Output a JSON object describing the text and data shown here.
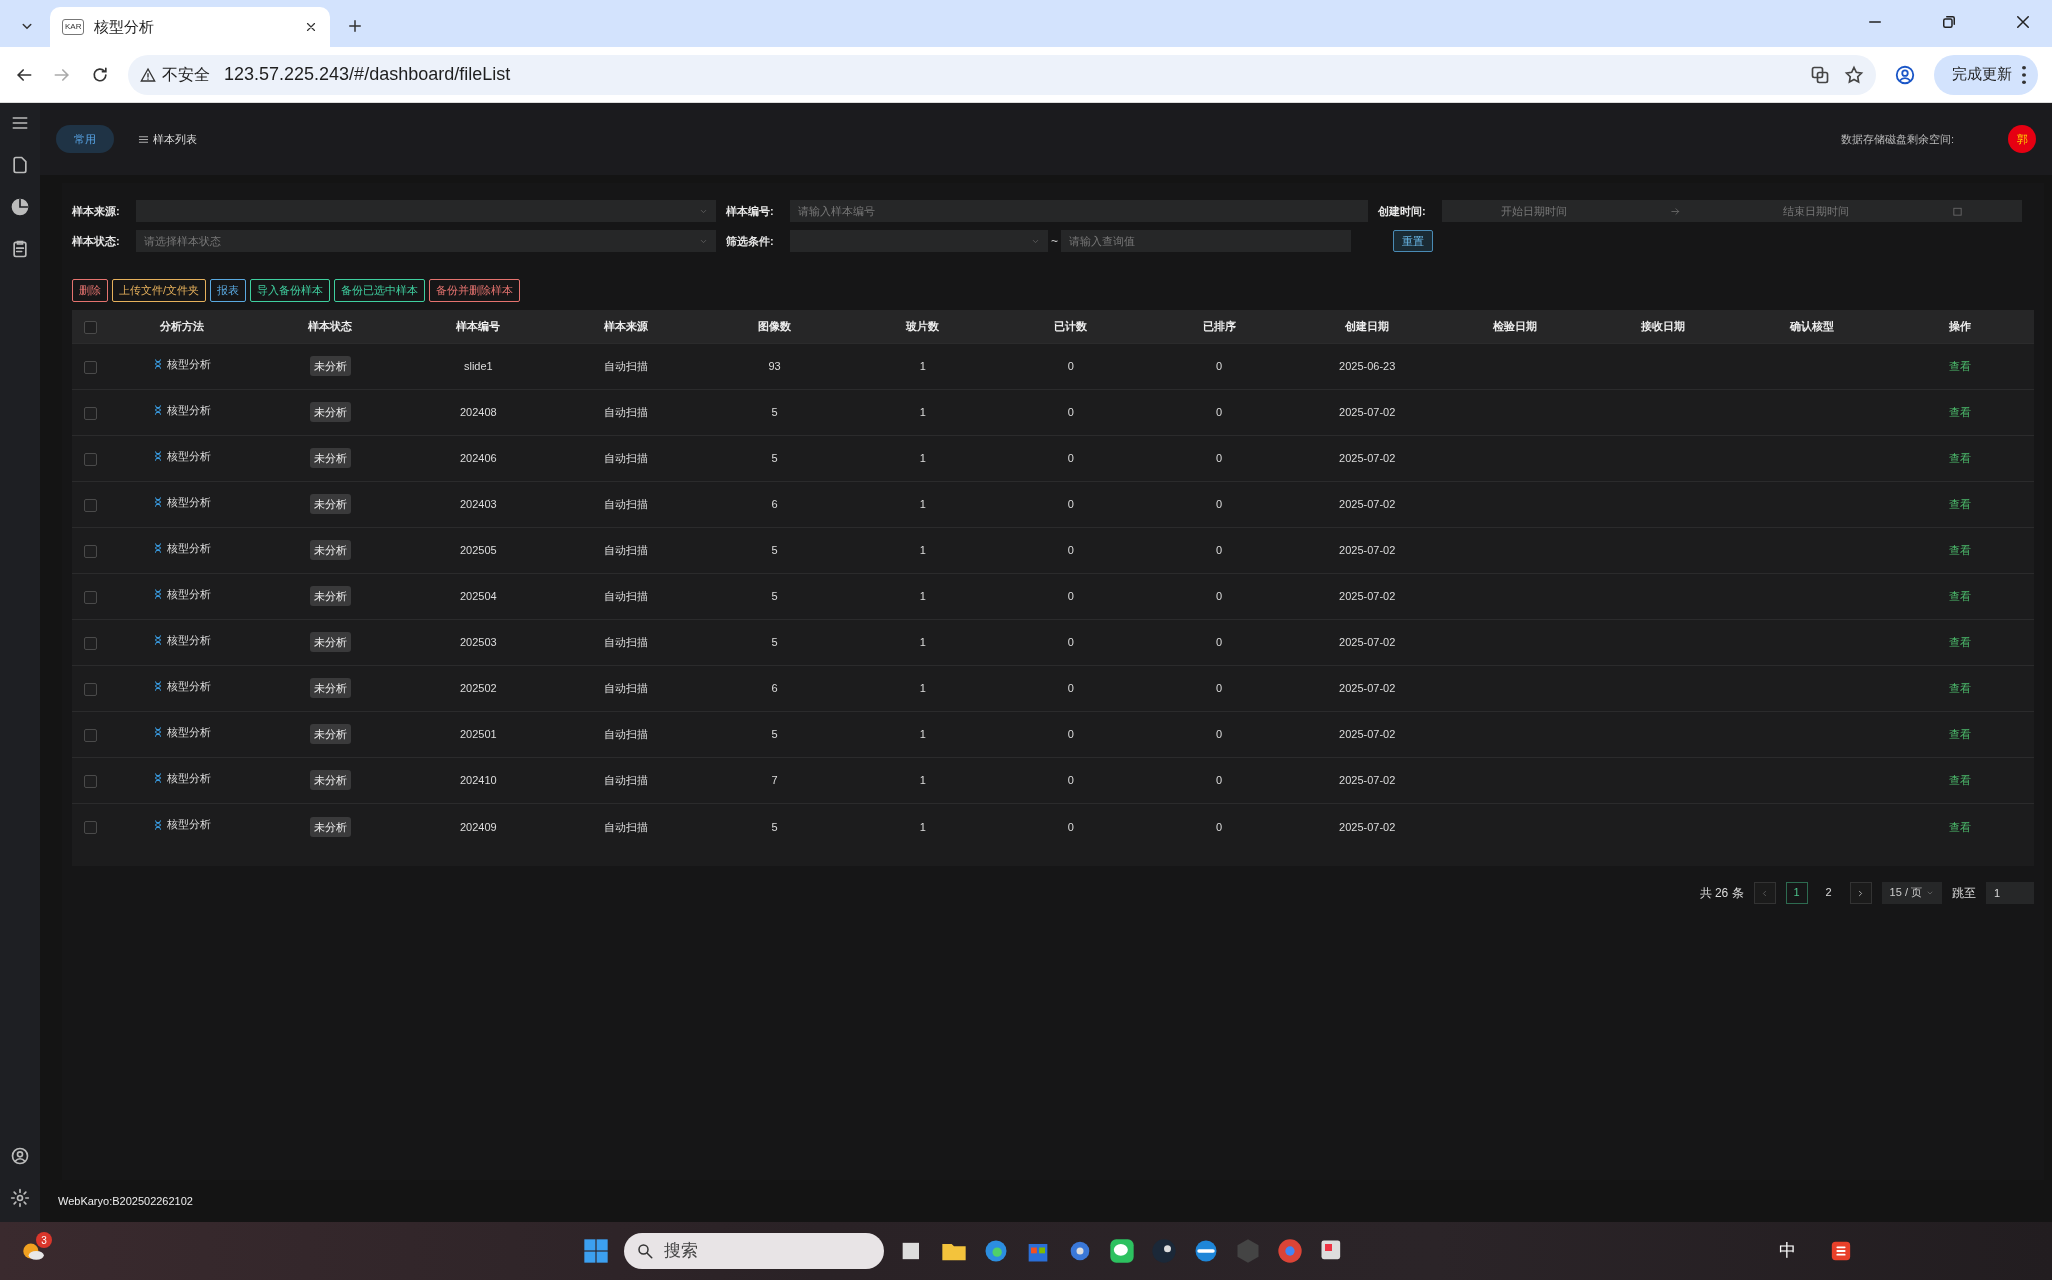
{
  "browser": {
    "tab_title": "核型分析",
    "tab_icon_text": "KAR",
    "security": "不安全",
    "url": "123.57.225.243/#/dashboard/fileList",
    "update_button": "完成更新"
  },
  "header": {
    "tabs": [
      {
        "label": "常用",
        "selected": true
      },
      {
        "label": "样本列表",
        "selected": false
      }
    ],
    "storage_label": "数据存储磁盘剩余空间:",
    "avatar": "郭"
  },
  "filters": {
    "source": {
      "label": "样本来源:"
    },
    "number": {
      "label": "样本编号:",
      "placeholder": "请输入样本编号"
    },
    "created": {
      "label": "创建时间:",
      "start_placeholder": "开始日期时间",
      "end_placeholder": "结束日期时间"
    },
    "status": {
      "label": "样本状态:",
      "placeholder": "请选择样本状态"
    },
    "condition": {
      "label": "筛选条件:",
      "separator": "~",
      "value_placeholder": "请输入查询值"
    },
    "reset_button": "重置"
  },
  "actions": [
    {
      "label": "删除",
      "color": "#e5736f"
    },
    {
      "label": "上传文件/文件夹",
      "color": "#e6b15c"
    },
    {
      "label": "报表",
      "color": "#5aa9e0"
    },
    {
      "label": "导入备份样本",
      "color": "#3fcf9f"
    },
    {
      "label": "备份已选中样本",
      "color": "#3fcf9f"
    },
    {
      "label": "备份并删除样本",
      "color": "#e5736f"
    }
  ],
  "table": {
    "all_checked": false,
    "columns": [
      "分析方法",
      "样本状态",
      "样本编号",
      "样本来源",
      "图像数",
      "玻片数",
      "已计数",
      "已排序",
      "创建日期",
      "检验日期",
      "接收日期",
      "确认核型",
      "操作"
    ],
    "rows": [
      {
        "checked": false,
        "method": "核型分析",
        "status": "未分析",
        "number": "slide1",
        "source": "自动扫描",
        "images": "93",
        "slides": "1",
        "counted": "0",
        "sorted": "0",
        "created": "2025-06-23",
        "action": "查看"
      },
      {
        "checked": false,
        "method": "核型分析",
        "status": "未分析",
        "number": "202408",
        "source": "自动扫描",
        "images": "5",
        "slides": "1",
        "counted": "0",
        "sorted": "0",
        "created": "2025-07-02",
        "action": "查看"
      },
      {
        "checked": false,
        "method": "核型分析",
        "status": "未分析",
        "number": "202406",
        "source": "自动扫描",
        "images": "5",
        "slides": "1",
        "counted": "0",
        "sorted": "0",
        "created": "2025-07-02",
        "action": "查看"
      },
      {
        "checked": false,
        "method": "核型分析",
        "status": "未分析",
        "number": "202403",
        "source": "自动扫描",
        "images": "6",
        "slides": "1",
        "counted": "0",
        "sorted": "0",
        "created": "2025-07-02",
        "action": "查看"
      },
      {
        "checked": false,
        "method": "核型分析",
        "status": "未分析",
        "number": "202505",
        "source": "自动扫描",
        "images": "5",
        "slides": "1",
        "counted": "0",
        "sorted": "0",
        "created": "2025-07-02",
        "action": "查看"
      },
      {
        "checked": false,
        "method": "核型分析",
        "status": "未分析",
        "number": "202504",
        "source": "自动扫描",
        "images": "5",
        "slides": "1",
        "counted": "0",
        "sorted": "0",
        "created": "2025-07-02",
        "action": "查看"
      },
      {
        "checked": false,
        "method": "核型分析",
        "status": "未分析",
        "number": "202503",
        "source": "自动扫描",
        "images": "5",
        "slides": "1",
        "counted": "0",
        "sorted": "0",
        "created": "2025-07-02",
        "action": "查看"
      },
      {
        "checked": false,
        "method": "核型分析",
        "status": "未分析",
        "number": "202502",
        "source": "自动扫描",
        "images": "6",
        "slides": "1",
        "counted": "0",
        "sorted": "0",
        "created": "2025-07-02",
        "action": "查看"
      },
      {
        "checked": false,
        "method": "核型分析",
        "status": "未分析",
        "number": "202501",
        "source": "自动扫描",
        "images": "5",
        "slides": "1",
        "counted": "0",
        "sorted": "0",
        "created": "2025-07-02",
        "action": "查看"
      },
      {
        "checked": false,
        "method": "核型分析",
        "status": "未分析",
        "number": "202410",
        "source": "自动扫描",
        "images": "7",
        "slides": "1",
        "counted": "0",
        "sorted": "0",
        "created": "2025-07-02",
        "action": "查看"
      },
      {
        "checked": false,
        "method": "核型分析",
        "status": "未分析",
        "number": "202409",
        "source": "自动扫描",
        "images": "5",
        "slides": "1",
        "counted": "0",
        "sorted": "0",
        "created": "2025-07-02",
        "action": "查看"
      }
    ]
  },
  "pagination": {
    "total": "共 26 条",
    "pages": [
      {
        "label": "1",
        "selected": true
      },
      {
        "label": "2",
        "selected": false
      }
    ],
    "page_size": "15 / 页",
    "jump_label": "跳至",
    "jump_value": "1"
  },
  "footer": "WebKaryo:B202502262102",
  "taskbar": {
    "weather_badge": "3",
    "search_placeholder": "搜索",
    "ime": "中"
  }
}
